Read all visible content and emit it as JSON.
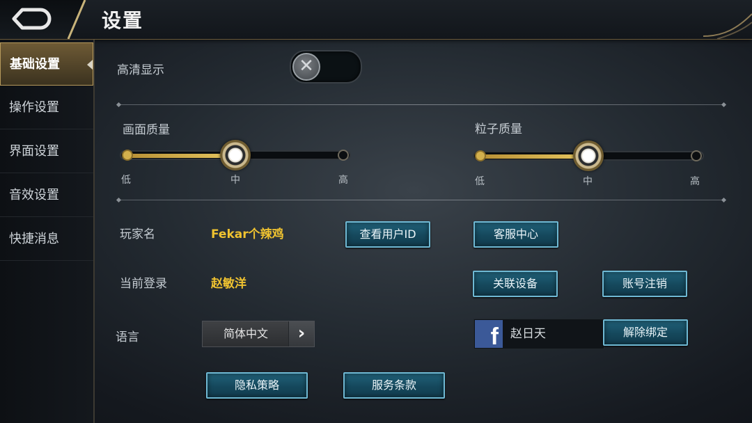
{
  "header": {
    "title": "设置"
  },
  "sidebar": {
    "items": [
      {
        "label": "基础设置",
        "active": true
      },
      {
        "label": "操作设置"
      },
      {
        "label": "界面设置"
      },
      {
        "label": "音效设置"
      },
      {
        "label": "快捷消息"
      }
    ]
  },
  "display": {
    "hd_label": "高清显示",
    "hd_enabled": false
  },
  "quality": {
    "image": {
      "label": "画面质量",
      "levels": [
        "低",
        "中",
        "高"
      ],
      "selected": "中"
    },
    "particle": {
      "label": "粒子质量",
      "levels": [
        "低",
        "中",
        "高"
      ],
      "selected": "中"
    }
  },
  "account": {
    "player_name_label": "玩家名",
    "player_name": "Fekar个辣鸡",
    "current_login_label": "当前登录",
    "current_login": "赵敏洋",
    "view_uid_button": "查看用户ID",
    "support_button": "客服中心",
    "link_device_button": "关联设备",
    "delete_account_button": "账号注销"
  },
  "language": {
    "label": "语言",
    "value": "简体中文"
  },
  "facebook": {
    "name": "赵日天",
    "unbind_button": "解除绑定",
    "logo_letter": "f"
  },
  "footer": {
    "privacy_button": "隐私策略",
    "terms_button": "服务条款"
  },
  "colors": {
    "accent_gold": "#f0c330",
    "button_blue": "#15485c",
    "facebook": "#3b5998"
  }
}
